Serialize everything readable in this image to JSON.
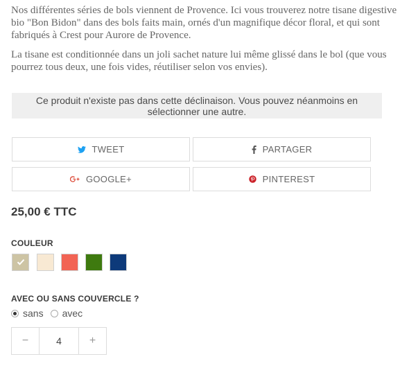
{
  "description": {
    "paragraph1": "Nos différentes séries de bols viennent de Provence. Ici vous trouverez notre tisane digestive bio \"Bon Bidon\" dans des bols faits main, ornés d'un magnifique décor floral, et qui sont fabriqués à Crest pour Aurore de Provence.",
    "paragraph2": "La tisane est conditionnée dans un joli sachet nature lui même glissé dans le bol (que vous pourrez tous deux, une fois vides, réutiliser selon vos envies)."
  },
  "notice": "Ce produit n'existe pas dans cette déclinaison. Vous pouvez néanmoins en sélectionner une autre.",
  "share": {
    "tweet": {
      "label": "TWEET",
      "icon": "twitter-icon",
      "color": "#1da1f2"
    },
    "partager": {
      "label": "PARTAGER",
      "icon": "facebook-icon",
      "color": "#3b5998"
    },
    "google": {
      "label": "GOOGLE+",
      "icon": "google-plus-icon",
      "color": "#dd4b39"
    },
    "pinterest": {
      "label": "PINTEREST",
      "icon": "pinterest-icon",
      "color": "#cb2027"
    }
  },
  "price": "25,00 € TTC",
  "couleur": {
    "label": "COULEUR",
    "swatches": [
      {
        "name": "beige",
        "color": "#cdc4a4",
        "selected": true
      },
      {
        "name": "creme",
        "color": "#f8e9d3",
        "selected": false
      },
      {
        "name": "corail",
        "color": "#f26454",
        "selected": false
      },
      {
        "name": "vert",
        "color": "#3e7a0f",
        "selected": false
      },
      {
        "name": "bleu",
        "color": "#0d3a7a",
        "selected": false
      }
    ]
  },
  "couvercle": {
    "label": "AVEC OU SANS COUVERCLE ?",
    "options": [
      {
        "label": "sans",
        "checked": true
      },
      {
        "label": "avec",
        "checked": false
      }
    ]
  },
  "quantity": {
    "minus": "−",
    "value": "4",
    "plus": "+"
  }
}
